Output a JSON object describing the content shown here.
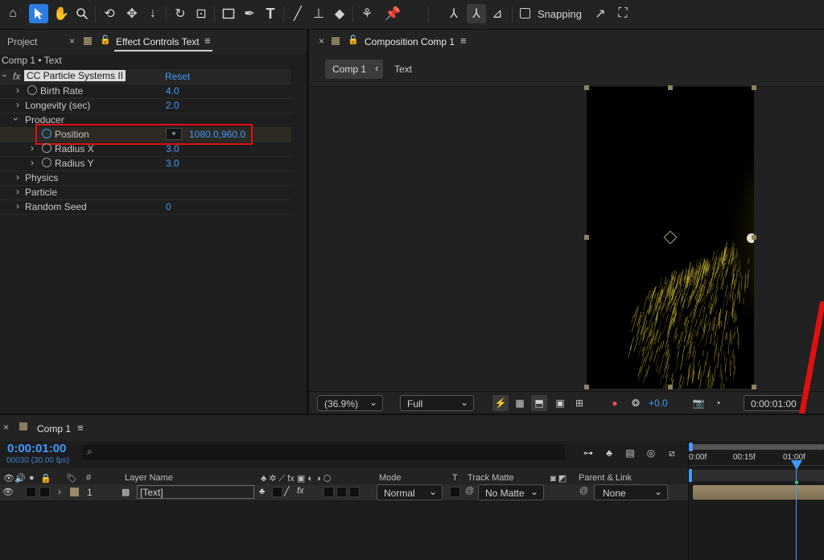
{
  "toolbar": {
    "snapping_label": "Snapping"
  },
  "left_panel": {
    "tab_project": "Project",
    "tab_effect": "Effect Controls Text",
    "breadcrumb": "Comp 1 • Text",
    "effect_name": "CC Particle Systems II",
    "reset_label": "Reset",
    "props": [
      {
        "label": "Birth Rate",
        "value": "4.0"
      },
      {
        "label": "Longevity (sec)",
        "value": "2.0"
      },
      {
        "label": "Producer",
        "value": ""
      },
      {
        "label": "Position",
        "value": "1080.0,960.0"
      },
      {
        "label": "Radius X",
        "value": "3.0"
      },
      {
        "label": "Radius Y",
        "value": "3.0"
      },
      {
        "label": "Physics",
        "value": ""
      },
      {
        "label": "Particle",
        "value": ""
      },
      {
        "label": "Random Seed",
        "value": "0"
      }
    ]
  },
  "comp_panel": {
    "tab_label": "Composition Comp 1",
    "nav_comp": "Comp 1",
    "nav_layer": "Text",
    "zoom": "(36.9%)",
    "resolution": "Full",
    "exposure": "+0.0",
    "timecode": "0:00:01:00"
  },
  "timeline": {
    "tab_label": "Comp 1",
    "current_time": "0:00:01:00",
    "frames_fps": "00030 (30.00 fps)",
    "search_placeholder": "",
    "col_hash": "#",
    "col_layer_name": "Layer Name",
    "col_mode": "Mode",
    "col_t": "T",
    "col_track_matte": "Track Matte",
    "col_parent": "Parent & Link",
    "layer": {
      "index": "1",
      "name": "[Text]",
      "mode": "Normal",
      "matte": "No Matte",
      "parent": "None"
    },
    "ruler_labels": [
      "0:00f",
      "00:15f",
      "01:00f"
    ]
  },
  "colors": {
    "accent": "#2d7de0",
    "value_blue": "#3f9bff",
    "highlight_red": "#e01010",
    "particle_gold": "#d8c23a"
  }
}
